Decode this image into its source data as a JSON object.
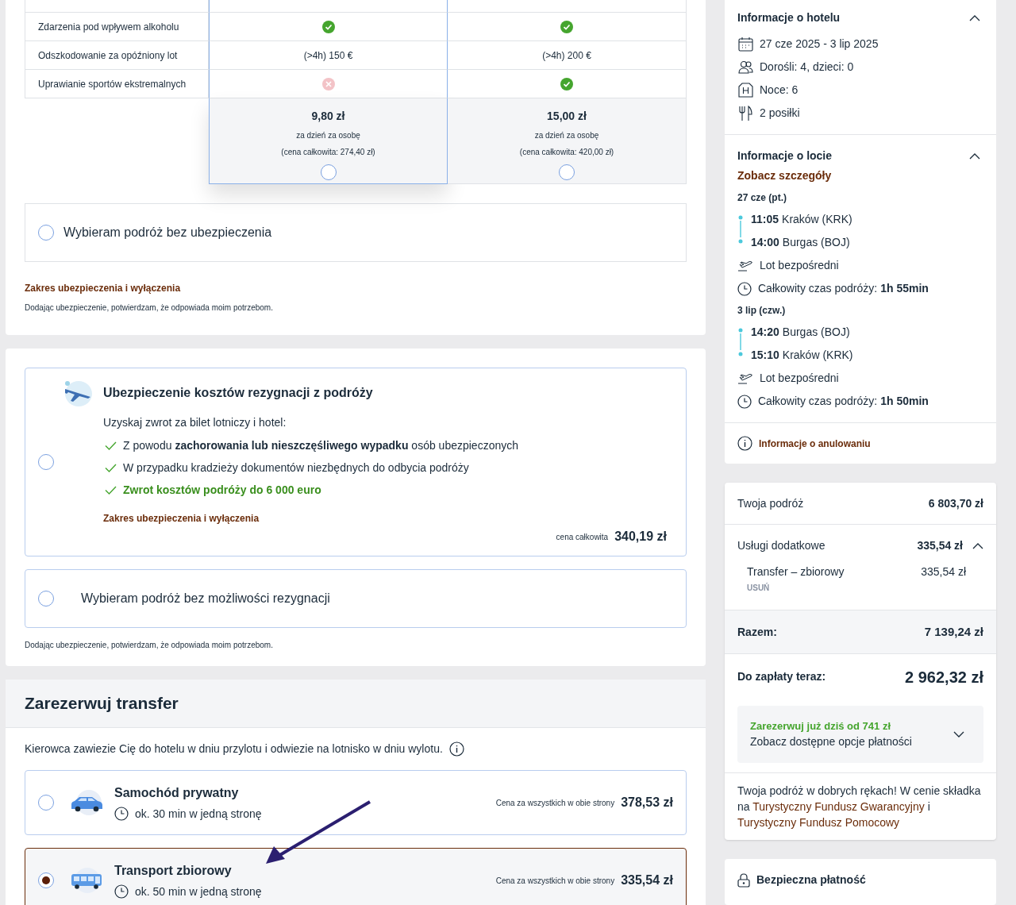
{
  "insurance_table": {
    "rows": [
      {
        "label": "Zdarzenia pod wpływem alkoholu",
        "cells": [
          {
            "kind": "check"
          },
          {
            "kind": "check"
          }
        ]
      },
      {
        "label": "Odszkodowanie za opóźniony lot",
        "cells": [
          {
            "kind": "text",
            "text": "(>4h) 150 €"
          },
          {
            "kind": "text",
            "text": "(>4h) 200 €"
          }
        ]
      },
      {
        "label": "Uprawianie sportów ekstremalnych",
        "cells": [
          {
            "kind": "cross"
          },
          {
            "kind": "check"
          }
        ]
      }
    ],
    "plans": [
      {
        "price": "9,80 zł",
        "per": "za dzień za osobę",
        "total": "(cena całkowita: 274,40 zł)",
        "selected": false,
        "highlighted": true
      },
      {
        "price": "15,00 zł",
        "per": "za dzień za osobę",
        "total": "(cena całkowita: 420,00 zł)",
        "selected": false,
        "highlighted": false
      }
    ],
    "no_insurance": {
      "label": "Wybieram podróż bez ubezpieczenia",
      "selected": false
    },
    "scope_link": "Zakres ubezpieczenia i wyłączenia",
    "note": "Dodając ubezpieczenie, potwierdzam, że odpowiada moim potrzebom."
  },
  "cancellation": {
    "title": "Ubezpieczenie kosztów rezygnacji z podróży",
    "selected": false,
    "intro": "Uzyskaj zwrot za bilet lotniczy i hotel:",
    "benefits": [
      {
        "text": "Z powodu **zachorowania lub nieszczęśliwego wypadku** osób ubezpieczonych",
        "highlight": false
      },
      {
        "text": "W przypadku kradzieży dokumentów niezbędnych do odbycia podróży",
        "highlight": false
      },
      {
        "text": "Zwrot kosztów podróży do 6 000 euro",
        "highlight": true
      }
    ],
    "scope_link": "Zakres ubezpieczenia i wyłączenia",
    "price_label": "cena całkowita",
    "price": "340,19 zł",
    "decline": {
      "label": "Wybieram podróż bez możliwości rezygnacji",
      "selected": false
    },
    "note": "Dodając ubezpieczenie, potwierdzam, że odpowiada moim potrzebom."
  },
  "transfer": {
    "title": "Zarezerwuj transfer",
    "description": "Kierowca zawiezie Cię do hotelu w dniu przylotu i odwiezie na lotnisko w dniu wylotu.",
    "options": [
      {
        "kind": "car",
        "name": "Samochód prywatny",
        "duration": "ok. 30 min w jedną stronę",
        "price_label": "Cena za wszystkich w obie strony",
        "price": "378,53 zł",
        "selected": false
      },
      {
        "kind": "bus",
        "name": "Transport zbiorowy",
        "duration": "ok. 50 min w jedną stronę",
        "price_label": "Cena za wszystkich w obie strony",
        "price": "335,54 zł",
        "selected": true
      }
    ]
  },
  "hotel_info": {
    "title": "Informacje o hotelu",
    "expanded": true,
    "items": [
      {
        "kind": "calendar",
        "text": "27 cze 2025 - 3 lip 2025"
      },
      {
        "kind": "people",
        "text": "Dorośli: 4, dzieci: 0"
      },
      {
        "kind": "hotel",
        "text": "Noce: 6"
      },
      {
        "kind": "meals",
        "text": "2 posiłki"
      }
    ]
  },
  "flight_info": {
    "title": "Informacje o locie",
    "expanded": true,
    "details_link": "Zobacz szczegóły",
    "legs": [
      {
        "date": "27 cze (pt.)",
        "stops": [
          {
            "time": "11:05",
            "place": "Kraków (KRK)"
          },
          {
            "time": "14:00",
            "place": "Burgas (BOJ)"
          }
        ],
        "type": "Lot bezpośredni",
        "duration_label": "Całkowity czas podróży:",
        "duration": "1h 55min"
      },
      {
        "date": "3 lip (czw.)",
        "stops": [
          {
            "time": "14:20",
            "place": "Burgas (BOJ)"
          },
          {
            "time": "15:10",
            "place": "Kraków (KRK)"
          }
        ],
        "type": "Lot bezpośredni",
        "duration_label": "Całkowity czas podróży:",
        "duration": "1h 50min"
      }
    ],
    "cancel_link": "Informacje o anulowaniu"
  },
  "summary": {
    "trip_label": "Twoja podróż",
    "trip_price": "6 803,70 zł",
    "extras_label": "Usługi dodatkowe",
    "extras_price": "335,54 zł",
    "extras_expanded": true,
    "extras": [
      {
        "name": "Transfer – zbiorowy",
        "price": "335,54 zł",
        "remove": "USUŃ"
      }
    ],
    "total_label": "Razem:",
    "total": "7 139,24 zł",
    "pay_now_label": "Do zapłaty teraz:",
    "pay_now": "2 962,32 zł",
    "promo_title": "Zarezerwuj już dziś od 741 zł",
    "promo_subtitle": "Zobacz dostępne opcje płatności",
    "promo_expanded": false,
    "trust_text": "Twoja podróż w dobrych rękach! W cenie składka na ",
    "trust_link_1": "Turystyczny Fundusz Gwarancyjny",
    "trust_and": " i ",
    "trust_link_2": "Turystyczny Fundusz Pomocowy"
  },
  "secure_payment": {
    "title": "Bezpieczna płatność"
  }
}
